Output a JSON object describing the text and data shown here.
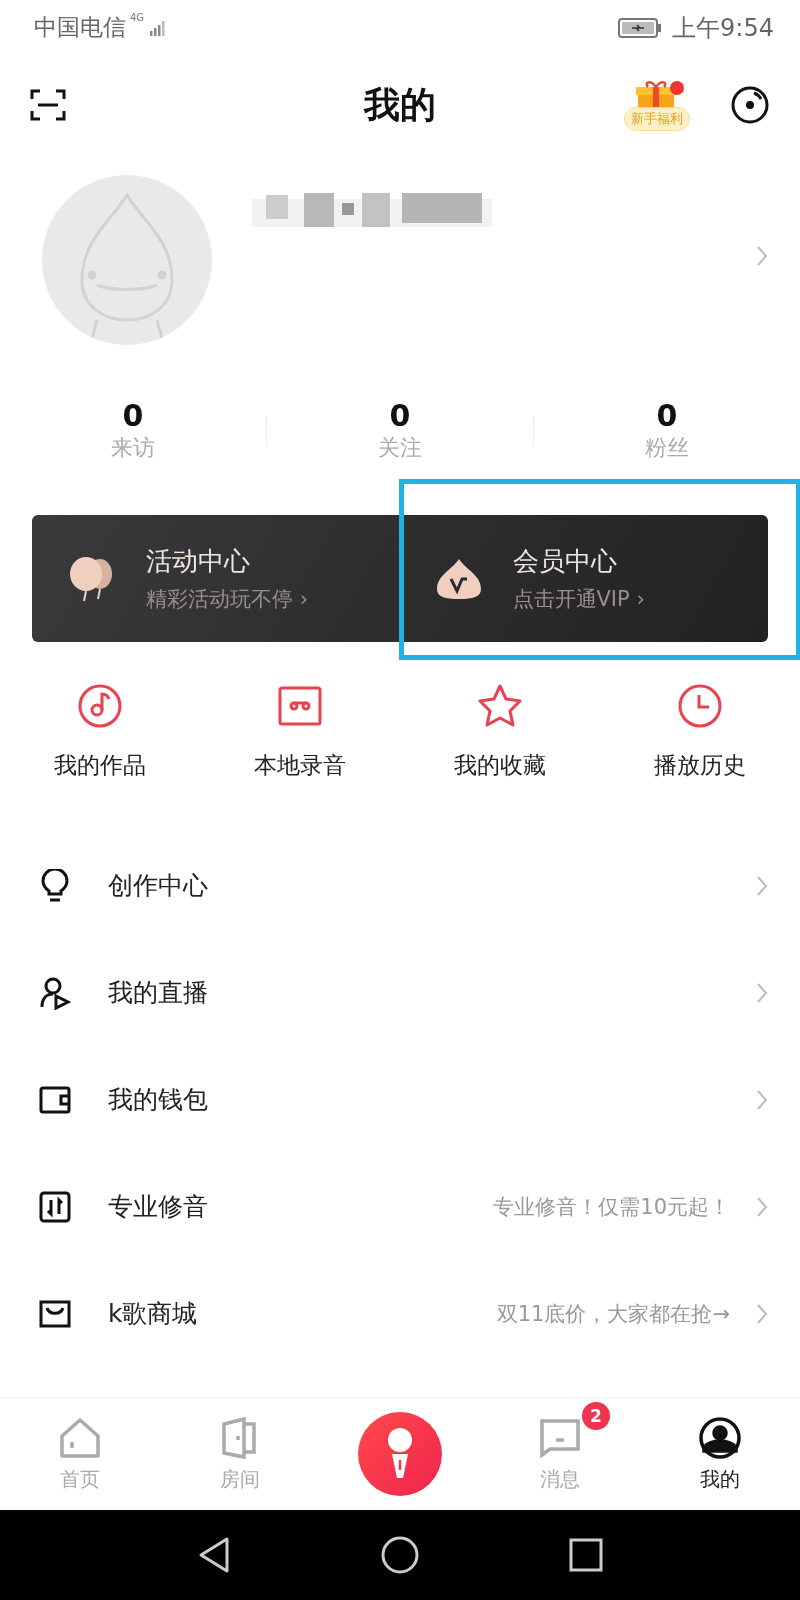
{
  "status_bar": {
    "carrier": "中国电信",
    "network": "4G",
    "time": "上午9:54"
  },
  "header": {
    "title": "我的",
    "gift_label": "新手福利",
    "gift_dot": true
  },
  "profile": {
    "stats": [
      {
        "value": "0",
        "label": "来访"
      },
      {
        "value": "0",
        "label": "关注"
      },
      {
        "value": "0",
        "label": "粉丝"
      }
    ]
  },
  "cards": [
    {
      "kind": "activity",
      "title": "活动中心",
      "subtitle": "精彩活动玩不停 ›"
    },
    {
      "kind": "vip",
      "title": "会员中心",
      "subtitle": "点击开通VIP ›",
      "highlighted": true
    }
  ],
  "shortcuts": [
    {
      "kind": "works",
      "label": "我的作品"
    },
    {
      "kind": "recording",
      "label": "本地录音"
    },
    {
      "kind": "favorites",
      "label": "我的收藏"
    },
    {
      "kind": "history",
      "label": "播放历史"
    }
  ],
  "menu": [
    {
      "kind": "bulb",
      "label": "创作中心"
    },
    {
      "kind": "live",
      "label": "我的直播"
    },
    {
      "kind": "wallet",
      "label": "我的钱包"
    },
    {
      "kind": "tuning",
      "label": "专业修音",
      "note": "专业修音！仅需10元起！"
    },
    {
      "kind": "shop",
      "label": "k歌商城",
      "note": "双11底价，大家都在抢→"
    }
  ],
  "tabs": [
    {
      "kind": "home",
      "label": "首页",
      "selected": false
    },
    {
      "kind": "room",
      "label": "房间",
      "selected": false
    },
    {
      "kind": "sing"
    },
    {
      "kind": "messages",
      "label": "消息",
      "selected": false,
      "badge": "2"
    },
    {
      "kind": "me",
      "label": "我的",
      "selected": true
    }
  ]
}
